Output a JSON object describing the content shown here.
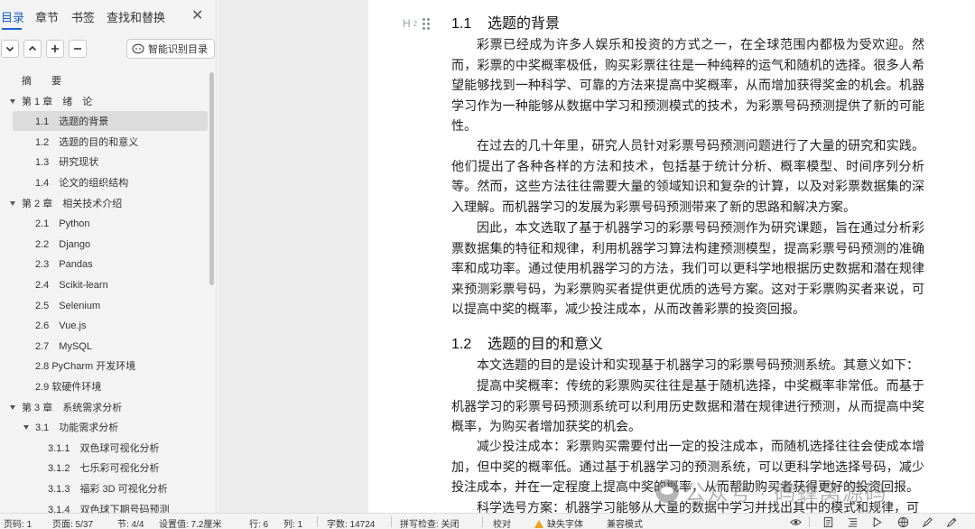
{
  "nav": {
    "tabs": [
      {
        "label": "目录",
        "active": true
      },
      {
        "label": "章节"
      },
      {
        "label": "书签"
      },
      {
        "label": "查找和替换"
      }
    ],
    "close_icon": "close-icon",
    "smart_toc_label": "智能识别目录"
  },
  "toc": [
    {
      "label": "摘　　要",
      "level": 0
    },
    {
      "label": "第 1 章　绪　论",
      "level": 1,
      "expanded": true
    },
    {
      "label": "1.1　选题的背景",
      "level": 2,
      "selected": true
    },
    {
      "label": "1.2　选题的目的和意义",
      "level": 2
    },
    {
      "label": "1.3　研究现状",
      "level": 2
    },
    {
      "label": "1.4　论文的组织结构",
      "level": 2
    },
    {
      "label": "第 2 章　相关技术介绍",
      "level": 1,
      "expanded": true
    },
    {
      "label": "2.1　Python",
      "level": 2
    },
    {
      "label": "2.2　Django",
      "level": 2
    },
    {
      "label": "2.3　Pandas",
      "level": 2
    },
    {
      "label": "2.4　Scikit-learn",
      "level": 2
    },
    {
      "label": "2.5　Selenium",
      "level": 2
    },
    {
      "label": "2.6　Vue.js",
      "level": 2
    },
    {
      "label": "2.7　MySQL",
      "level": 2
    },
    {
      "label": "2.8 PyCharm 开发环境",
      "level": 2
    },
    {
      "label": "2.9  软硬件环境",
      "level": 2
    },
    {
      "label": "第 3 章　系统需求分析",
      "level": 1,
      "expanded": true
    },
    {
      "label": "3.1　功能需求分析",
      "level": 2,
      "expanded": true
    },
    {
      "label": "3.1.1　双色球可视化分析",
      "level": 3
    },
    {
      "label": "3.1.2　七乐彩可视化分析",
      "level": 3
    },
    {
      "label": "3.1.3　福彩 3D 可视化分析",
      "level": 3
    },
    {
      "label": "3.1.4　双色球下期号码预测",
      "level": 3
    }
  ],
  "document": {
    "heading_marker": "H",
    "heading_marker_sub": "2",
    "sections": [
      {
        "number": "1.1",
        "title": "选题的背景",
        "paragraphs": [
          "彩票已经成为许多人娱乐和投资的方式之一，在全球范围内都极为受欢迎。然而，彩票的中奖概率极低，购买彩票往往是一种纯粹的运气和随机的选择。很多人希望能够找到一种科学、可靠的方法来提高中奖概率，从而增加获得奖金的机会。机器学习作为一种能够从数据中学习和预测模式的技术，为彩票号码预测提供了新的可能性。",
          "在过去的几十年里，研究人员针对彩票号码预测问题进行了大量的研究和实践。他们提出了各种各样的方法和技术，包括基于统计分析、概率模型、时间序列分析等。然而，这些方法往往需要大量的领域知识和复杂的计算，以及对彩票数据集的深入理解。而机器学习的发展为彩票号码预测带来了新的思路和解决方案。",
          "因此，本文选取了基于机器学习的彩票号码预测作为研究课题，旨在通过分析彩票数据集的特征和规律，利用机器学习算法构建预测模型，提高彩票号码预测的准确率和成功率。通过使用机器学习的方法，我们可以更科学地根据历史数据和潜在规律来预测彩票号码，为彩票购买者提供更优质的选号方案。这对于彩票购买者来说，可以提高中奖的概率，减少投注成本，从而改善彩票的投资回报。"
        ]
      },
      {
        "number": "1.2",
        "title": "选题的目的和意义",
        "paragraphs": [
          "本文选题的目的是设计和实现基于机器学习的彩票号码预测系统。其意义如下：",
          "提高中奖概率：传统的彩票购买往往是基于随机选择，中奖概率非常低。而基于机器学习的彩票号码预测系统可以利用历史数据和潜在规律进行预测，从而提高中奖概率，为购买者增加获奖的机会。",
          "减少投注成本：彩票购买需要付出一定的投注成本，而随机选择往往会使成本增加，但中奖的概率低。通过基于机器学习的预测系统，可以更科学地选择号码，减少投注成本，并在一定程度上提高中奖的概率，从而帮助购买者获得更好的投资回报。",
          "科学选号方案：机器学习能够从大量的数据中学习并找出其中的模式和规律，可"
        ]
      }
    ],
    "watermark": "公众号 · 码蜂窝源码"
  },
  "status": {
    "page_code": "页码: 1",
    "page": "页面: 5/37",
    "section": "节: 4/4",
    "setting": "设置值: 7.2厘米",
    "row": "行: 6",
    "col": "列: 1",
    "word_count": "字数: 14724",
    "spell_check": "拼写检查: 关闭",
    "proofread": "校对",
    "missing_font": "缺失字体",
    "compat_mode": "兼容模式",
    "icons": [
      "eye-icon",
      "page-view-icon",
      "outline-view-icon",
      "play-icon",
      "web-layout-icon",
      "write-mode-icon",
      "pen-icon"
    ]
  }
}
